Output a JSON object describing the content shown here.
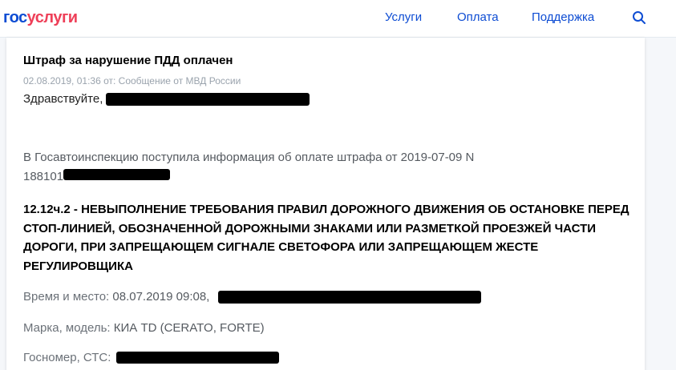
{
  "header": {
    "logo_part1": "гос",
    "logo_part2": "услуги",
    "nav": [
      "Услуги",
      "Оплата",
      "Поддержка"
    ],
    "search_icon": "search-icon",
    "brand_blue": "#0d4cd3",
    "brand_red": "#ee3f58"
  },
  "message": {
    "title": "Штраф за нарушение ПДД оплачен",
    "meta": "02.08.2019, 01:36 от: Сообщение от МВД России",
    "greeting": "Здравствуйте,",
    "info_text": "В Госавтоинспекцию поступила информация об оплате штрафа от 2019-07-09 N",
    "info_number": "188101",
    "violation": "12.12ч.2 - НЕВЫПОЛНЕНИЕ ТРЕБОВАНИЯ ПРАВИЛ ДОРОЖНОГО ДВИЖЕНИЯ ОБ ОСТАНОВКЕ ПЕРЕД СТОП-ЛИНИЕЙ, ОБОЗНАЧЕННОЙ ДОРОЖНЫМИ ЗНАКАМИ ИЛИ РАЗМЕТКОЙ ПРОЕЗЖЕЙ ЧАСТИ ДОРОГИ, ПРИ ЗАПРЕЩАЮЩЕМ СИГНАЛЕ СВЕТОФОРА ИЛИ ЗАПРЕЩАЮЩЕМ ЖЕСТЕ РЕГУЛИРОВЩИКА",
    "time_place_label": "Время и место:",
    "time_place_value": "08.07.2019 09:08,",
    "brand_model_label": "Марка, модель:",
    "brand_model_value": "КИА TD (CERATO, FORTE)",
    "plate_label": "Госномер, СТС:",
    "plate_value": ""
  }
}
